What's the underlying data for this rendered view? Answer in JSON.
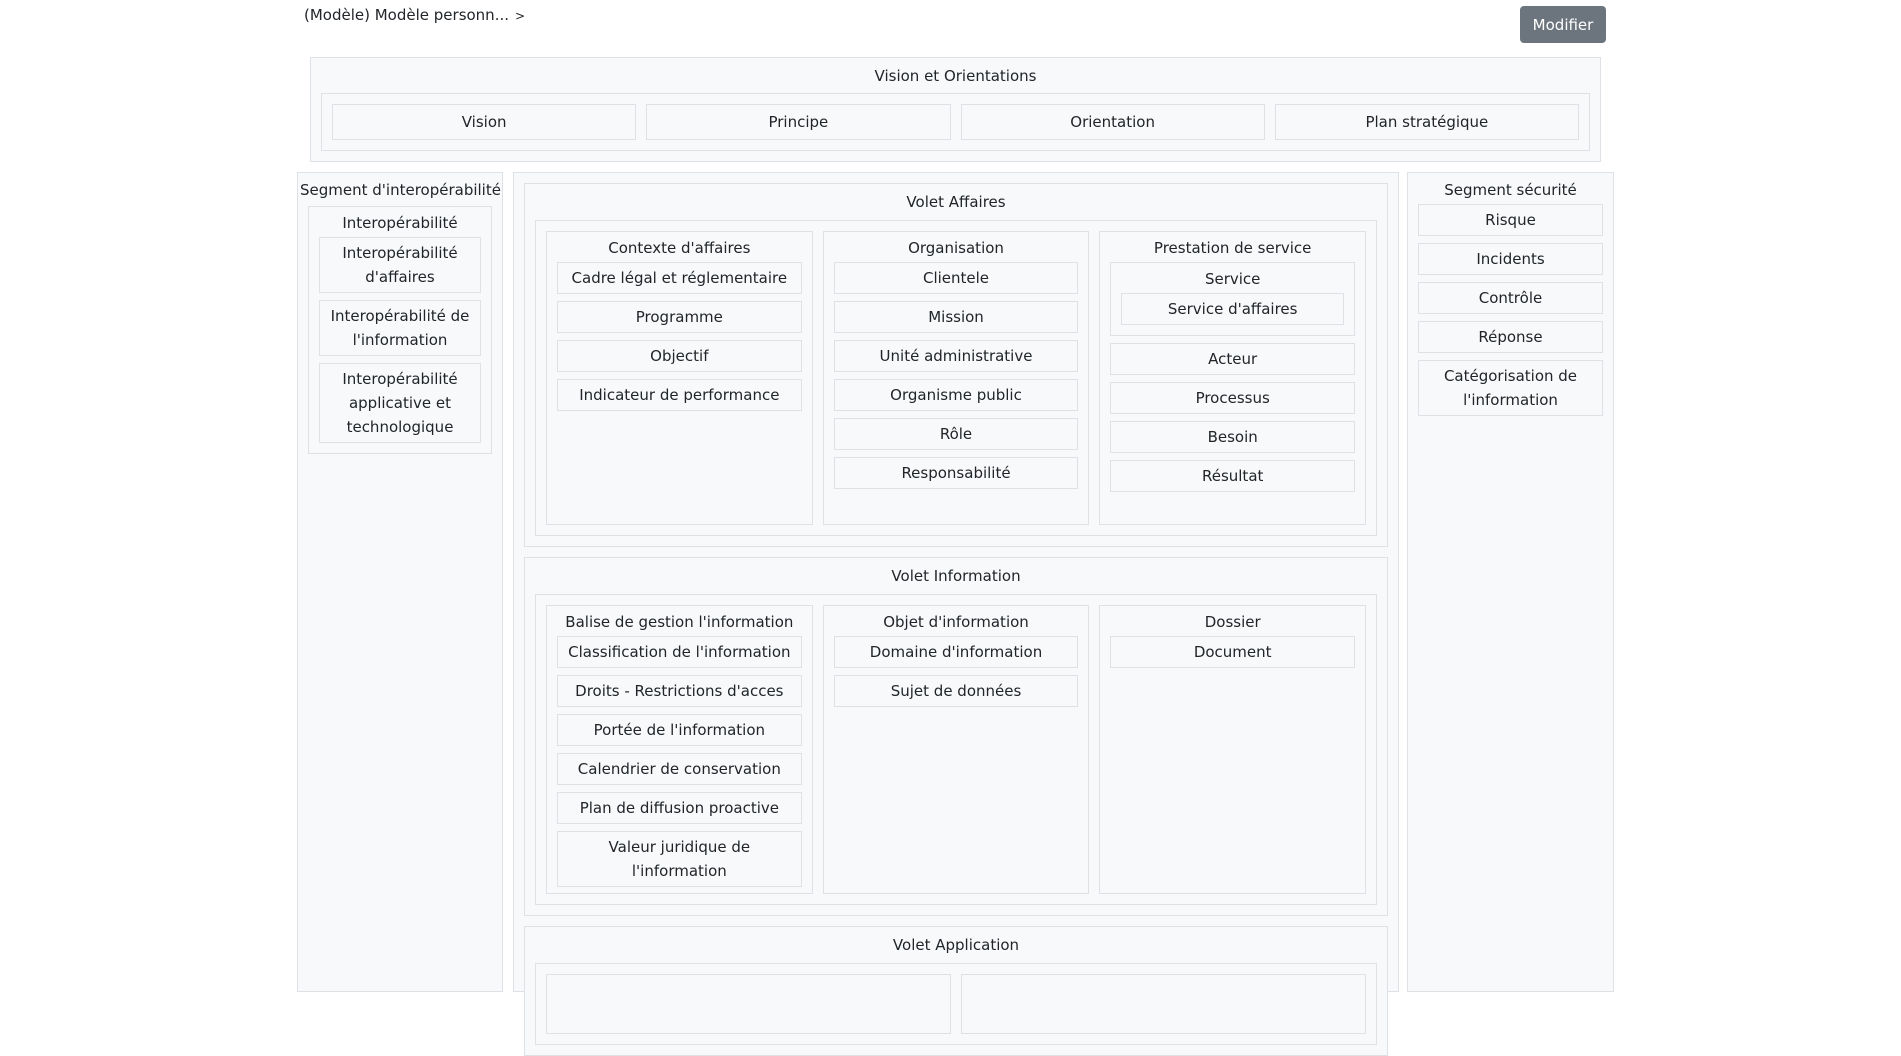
{
  "breadcrumb": {
    "label": "(Modèle) Modèle personn...",
    "separator": ">"
  },
  "toolbar": {
    "modify_label": "Modifier"
  },
  "vision": {
    "title": "Vision et Orientations",
    "items": [
      "Vision",
      "Principe",
      "Orientation",
      "Plan stratégique"
    ]
  },
  "segment_interop": {
    "title": "Segment d'interopérabilité",
    "group": {
      "title": "Interopérabilité",
      "items": [
        "Interopérabilité d'affaires",
        "Interopérabilité de l'information",
        "Interopérabilité applicative et technologique"
      ]
    }
  },
  "segment_securite": {
    "title": "Segment sécurité",
    "items": [
      "Risque",
      "Incidents",
      "Contrôle",
      "Réponse",
      "Catégorisation de l'information"
    ]
  },
  "volet_affaires": {
    "title": "Volet Affaires",
    "columns": [
      {
        "title": "Contexte d'affaires",
        "items": [
          "Cadre légal et réglementaire",
          "Programme",
          "Objectif",
          "Indicateur de performance"
        ]
      },
      {
        "title": "Organisation",
        "items": [
          "Clientele",
          "Mission",
          "Unité administrative",
          "Organisme public",
          "Rôle",
          "Responsabilité"
        ]
      },
      {
        "title": "Prestation de service",
        "subgroup": {
          "title": "Service",
          "items": [
            "Service d'affaires"
          ]
        },
        "items": [
          "Acteur",
          "Processus",
          "Besoin",
          "Résultat"
        ]
      }
    ]
  },
  "volet_information": {
    "title": "Volet Information",
    "columns": [
      {
        "title": "Balise de gestion l'information",
        "items": [
          "Classification de l'information",
          "Droits - Restrictions d'acces",
          "Portée de l'information",
          "Calendrier de conservation",
          "Plan de diffusion proactive",
          "Valeur juridique de l'information"
        ]
      },
      {
        "title": "Objet d'information",
        "items": [
          "Domaine d'information",
          "Sujet de données"
        ]
      },
      {
        "title": "Dossier",
        "items": [
          "Document"
        ]
      }
    ]
  },
  "volet_application": {
    "title": "Volet Application"
  }
}
